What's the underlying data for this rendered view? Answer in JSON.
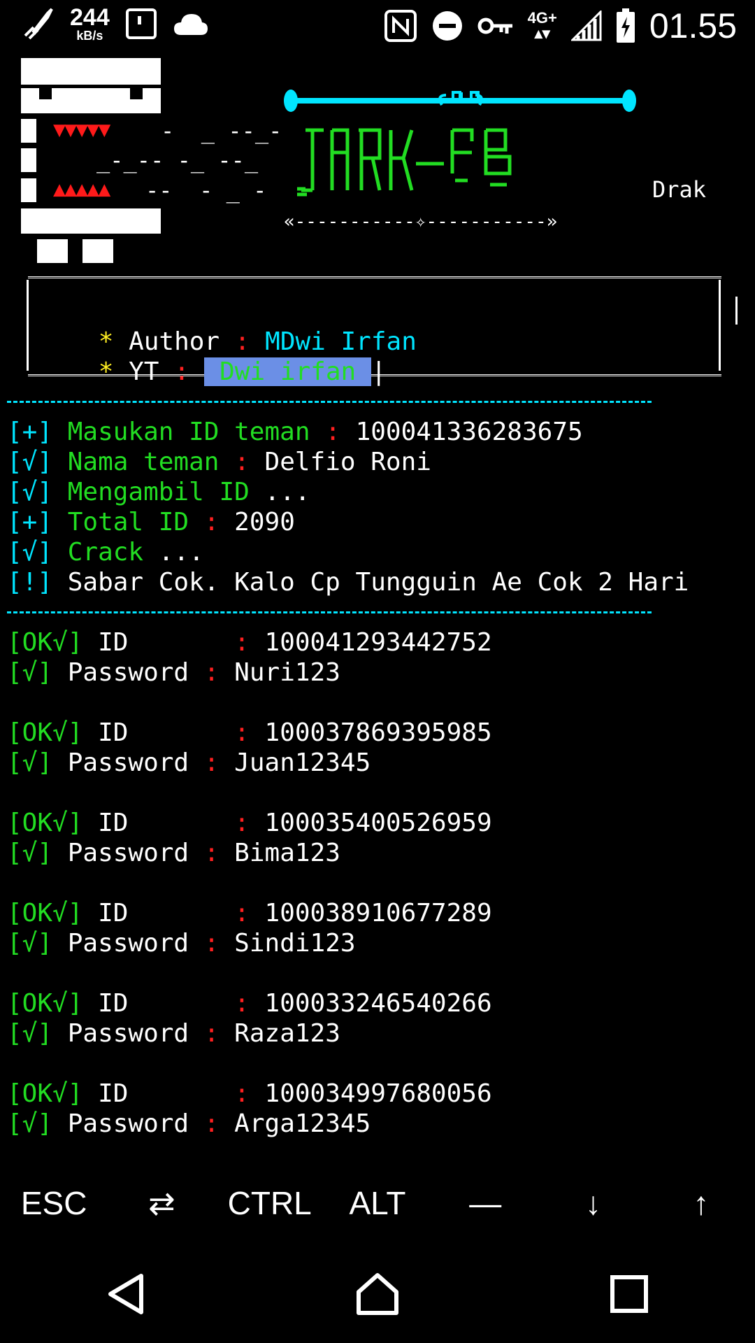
{
  "status": {
    "speed_value": "244",
    "speed_unit": "kB/s",
    "network": "4G+",
    "time": "01.55",
    "icons": [
      "rocket-icon",
      "sim-card-icon",
      "cloud-icon",
      "nfc-icon",
      "do-not-disturb-icon",
      "vpn-key-icon",
      "signal-icon",
      "battery-charging-icon"
    ]
  },
  "banner": {
    "side_text": "Drak",
    "tri_down": "▼▼▼▼▼",
    "tri_up": "▲▲▲▲▲",
    "dash1": "-  _ --_-",
    "dash2": "_-_-- -_ --_",
    "dash3": "--  - _ -",
    "logo_hint": "DARK-FB",
    "orn_bottom": "«-----------✧-----------»"
  },
  "info": {
    "author_label": "Author",
    "author_value": "MDwi Irfan",
    "yt_label": "YT",
    "yt_value": " Dwi irfan "
  },
  "log": [
    {
      "tag": "[+]",
      "label": "Masukan ID teman",
      "sep": ":",
      "value": "100041336283675"
    },
    {
      "tag": "[√]",
      "label": "Nama teman",
      "sep": ":",
      "value": "Delfio Roni"
    },
    {
      "tag": "[√]",
      "label": "Mengambil ID",
      "sep": "",
      "value": "..."
    },
    {
      "tag": "[+]",
      "label": "Total ID",
      "sep": ":",
      "value": "2090"
    },
    {
      "tag": "[√]",
      "label": "Crack",
      "sep": "",
      "value": "..."
    },
    {
      "tag": "[!]",
      "label": "",
      "sep": "",
      "value": "Sabar Cok. Kalo Cp Tungguin Ae Cok 2 Hari"
    }
  ],
  "results": [
    {
      "ok": "[OK√]",
      "id_label": "ID",
      "id": "100041293442752",
      "pw_tag": "[√]",
      "pw_label": "Password",
      "pw": "Nuri123"
    },
    {
      "ok": "[OK√]",
      "id_label": "ID",
      "id": "100037869395985",
      "pw_tag": "[√]",
      "pw_label": "Password",
      "pw": "Juan12345"
    },
    {
      "ok": "[OK√]",
      "id_label": "ID",
      "id": "100035400526959",
      "pw_tag": "[√]",
      "pw_label": "Password",
      "pw": "Bima123"
    },
    {
      "ok": "[OK√]",
      "id_label": "ID",
      "id": "100038910677289",
      "pw_tag": "[√]",
      "pw_label": "Password",
      "pw": "Sindi123"
    },
    {
      "ok": "[OK√]",
      "id_label": "ID",
      "id": "100033246540266",
      "pw_tag": "[√]",
      "pw_label": "Password",
      "pw": "Raza123"
    },
    {
      "ok": "[OK√]",
      "id_label": "ID",
      "id": "100034997680056",
      "pw_tag": "[√]",
      "pw_label": "Password",
      "pw": "Arga12345"
    }
  ],
  "keys": [
    "ESC",
    "⇄",
    "CTRL",
    "ALT",
    "—",
    "↓",
    "↑"
  ],
  "nav": [
    "back-icon",
    "home-icon",
    "recents-icon"
  ],
  "colors": {
    "green": "#22dd22",
    "cyan": "#00e5ff",
    "red": "#ff2020",
    "yellow": "#ffee22",
    "highlight": "#6b8fe6"
  }
}
